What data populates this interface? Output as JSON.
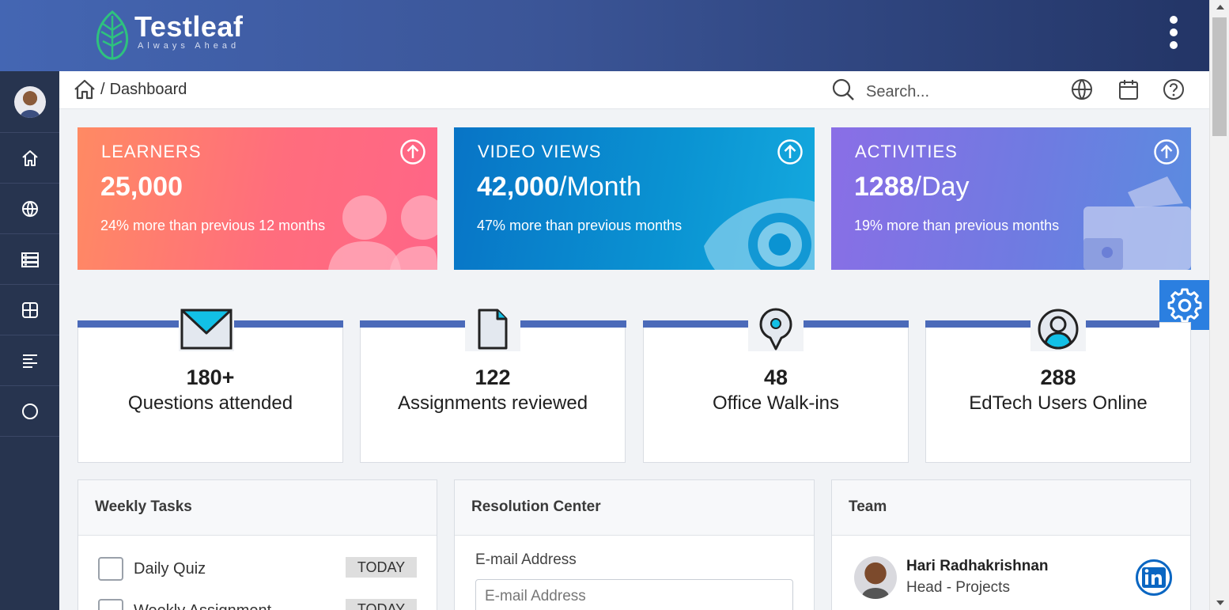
{
  "header": {
    "logo_name": "Testleaf",
    "logo_tagline": "Always Ahead",
    "menu_icon": "more-vertical-icon"
  },
  "sidebar": {
    "items": [
      {
        "icon": "home-icon"
      },
      {
        "icon": "globe-icon"
      },
      {
        "icon": "server-icon"
      },
      {
        "icon": "grid-icon"
      },
      {
        "icon": "align-left-icon"
      },
      {
        "icon": "circle-icon"
      }
    ]
  },
  "breadcrumb": {
    "separator": "/",
    "current": "Dashboard"
  },
  "search": {
    "placeholder": "Search..."
  },
  "stats": [
    {
      "title": "LEARNERS",
      "value_bold": "25,000",
      "value_suffix": "",
      "subtitle": "24% more than previous 12 months",
      "color_start": "#ff8a63",
      "color_end": "#ff6587"
    },
    {
      "title": "VIDEO VIEWS",
      "value_bold": "42,000",
      "value_suffix": "/Month",
      "subtitle": "47% more than previous months",
      "color_start": "#0874c6",
      "color_end": "#14a9de"
    },
    {
      "title": "ACTIVITIES",
      "value_bold": "1288",
      "value_suffix": "/Day",
      "subtitle": "19% more than previous months",
      "color_start": "#8a6ee6",
      "color_end": "#5a8ce0"
    }
  ],
  "metrics": [
    {
      "value": "180+",
      "label": "Questions attended",
      "icon": "envelope-icon"
    },
    {
      "value": "122",
      "label": "Assignments reviewed",
      "icon": "file-icon"
    },
    {
      "value": "48",
      "label": "Office Walk-ins",
      "icon": "map-pin-icon"
    },
    {
      "value": "288",
      "label": "EdTech Users Online",
      "icon": "user-circle-icon"
    }
  ],
  "panels": {
    "weekly_tasks": {
      "title": "Weekly Tasks",
      "tasks": [
        {
          "label": "Daily Quiz",
          "badge": "TODAY"
        },
        {
          "label": "Weekly Assignment",
          "badge": "TODAY"
        }
      ]
    },
    "resolution_center": {
      "title": "Resolution Center",
      "email_label": "E-mail Address",
      "email_placeholder": "E-mail Address"
    },
    "team": {
      "title": "Team",
      "members": [
        {
          "name": "Hari Radhakrishnan",
          "role": "Head - Projects"
        }
      ]
    }
  },
  "colors": {
    "accent": "#4b6ab9",
    "settings_button": "#2b7fe0",
    "sidebar": "#27344f"
  }
}
